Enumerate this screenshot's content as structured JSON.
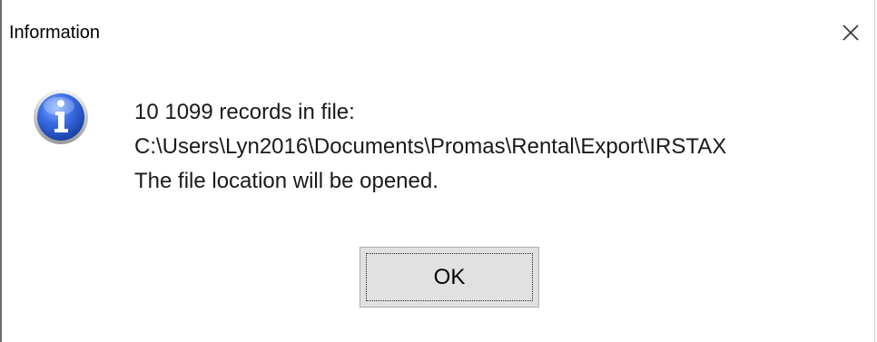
{
  "window": {
    "title": "Information",
    "close_icon": "close-icon"
  },
  "message": {
    "icon": "info-icon",
    "line1": "10 1099 records in file:",
    "line2": "C:\\Users\\Lyn2016\\Documents\\Promas\\Rental\\Export\\IRSTAX",
    "line3": "The file location will be opened."
  },
  "buttons": {
    "ok_label": "OK"
  },
  "colors": {
    "icon_blue": "#2a5bd7",
    "button_face": "#e1e1e1",
    "button_border": "#adadad"
  }
}
